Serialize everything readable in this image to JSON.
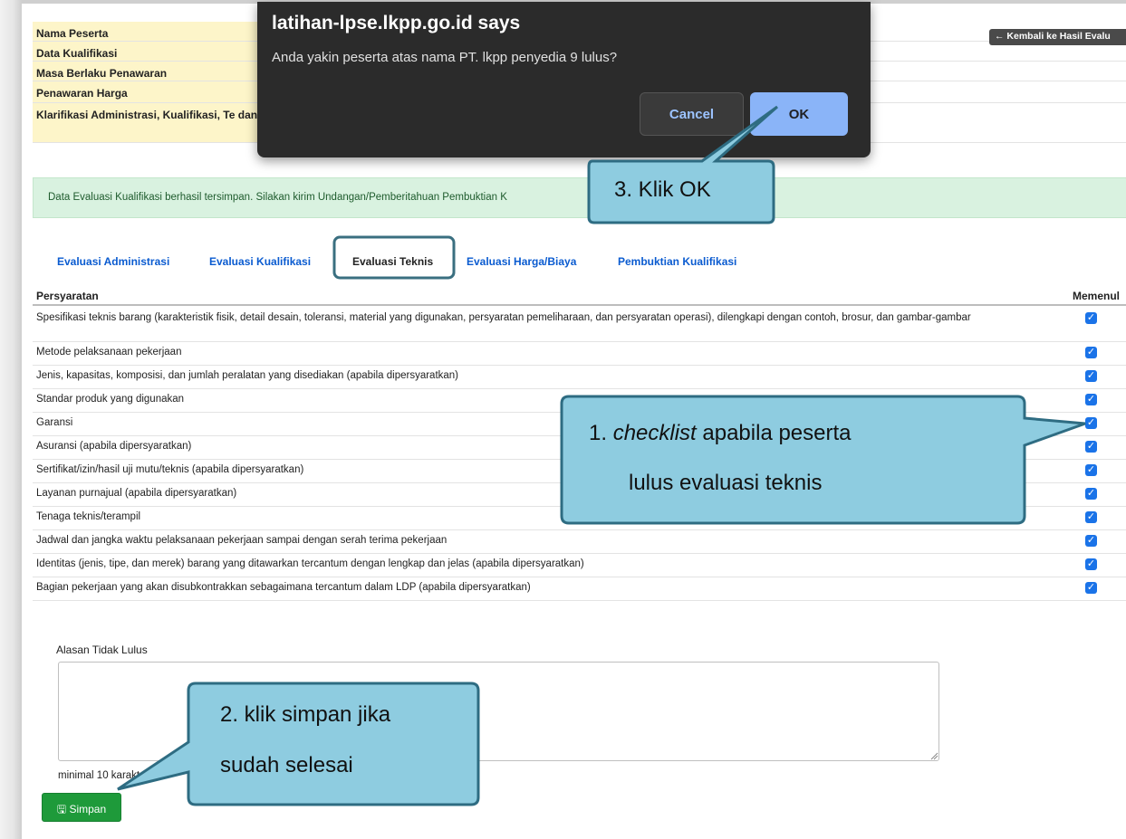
{
  "info_rows": [
    {
      "label": "Nama Peserta"
    },
    {
      "label": "Data Kualifikasi"
    },
    {
      "label": "Masa Berlaku Penawaran"
    },
    {
      "label": "Penawaran Harga"
    },
    {
      "label": "Klarifikasi Administrasi, Kualifikasi, Te dan Harga"
    }
  ],
  "back_button": "← Kembali ke Hasil Evalu",
  "alert_text": "Data Evaluasi Kualifikasi berhasil tersimpan. Silakan kirim Undangan/Pemberitahuan Pembuktian K",
  "tabs": [
    {
      "label": "Evaluasi Administrasi"
    },
    {
      "label": "Evaluasi Kualifikasi"
    },
    {
      "label": "Evaluasi Teknis"
    },
    {
      "label": "Evaluasi Harga/Biaya"
    },
    {
      "label": "Pembuktian Kualifikasi"
    }
  ],
  "table": {
    "col_requirement": "Persyaratan",
    "col_memenuhi": "Memenul",
    "rows": [
      {
        "text": "Spesifikasi teknis barang (karakteristik fisik, detail desain, toleransi, material yang digunakan, persyaratan pemeliharaan, dan persyaratan operasi), dilengkapi dengan contoh, brosur, dan gambar-gambar",
        "checked": true
      },
      {
        "text": "Metode pelaksanaan pekerjaan",
        "checked": true
      },
      {
        "text": "Jenis, kapasitas, komposisi, dan jumlah peralatan yang disediakan (apabila dipersyaratkan)",
        "checked": true
      },
      {
        "text": "Standar produk yang digunakan",
        "checked": true
      },
      {
        "text": "Garansi",
        "checked": true
      },
      {
        "text": "Asuransi (apabila dipersyaratkan)",
        "checked": true
      },
      {
        "text": "Sertifikat/izin/hasil uji mutu/teknis (apabila dipersyaratkan)",
        "checked": true
      },
      {
        "text": "Layanan purnajual (apabila dipersyaratkan)",
        "checked": true
      },
      {
        "text": "Tenaga teknis/terampil",
        "checked": true
      },
      {
        "text": "Jadwal dan jangka waktu pelaksanaan pekerjaan sampai dengan serah terima pekerjaan",
        "checked": true
      },
      {
        "text": "Identitas (jenis, tipe, dan merek) barang yang ditawarkan tercantum dengan lengkap dan jelas (apabila dipersyaratkan)",
        "checked": true
      },
      {
        "text": "Bagian pekerjaan yang akan disubkontrakkan sebagaimana tercantum dalam LDP (apabila dipersyaratkan)",
        "checked": true
      }
    ]
  },
  "alasan_label": "Alasan Tidak Lulus",
  "minimal_text": "minimal 10 karakter",
  "simpan_label": "Simpan",
  "dialog": {
    "title": "latihan-lpse.lkpp.go.id says",
    "message": "Anda yakin peserta atas nama PT. lkpp penyedia 9 lulus?",
    "cancel": "Cancel",
    "ok": "OK"
  },
  "callouts": {
    "c1_italic": "checklist",
    "c1_prefix": "1. ",
    "c1_rest": " apabila peserta",
    "c1_line2": "lulus evaluasi teknis",
    "c2_line1": "2. klik simpan jika",
    "c2_line2": "sudah selesai",
    "c3": "3. Klik OK"
  },
  "colors": {
    "callout_fill": "#8ecce0",
    "callout_stroke": "#2e6c82",
    "tab_highlight": "#3a6f80"
  }
}
